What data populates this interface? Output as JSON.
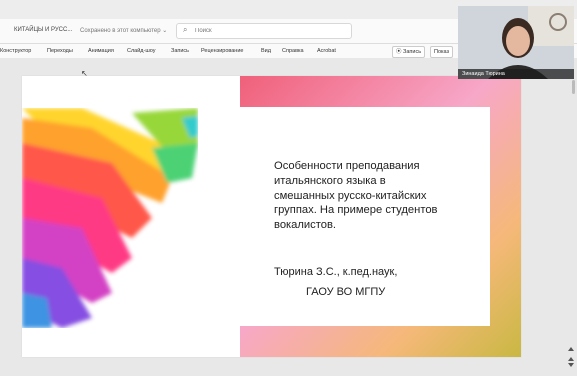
{
  "app": {
    "doc_name": "КИТАЙЦЫ И РУСС...",
    "save_state": "Сохранено в этот компьютер ⌄",
    "search_placeholder": "Поиск"
  },
  "menu": {
    "items": [
      "Конструктор",
      "Переходы",
      "Анимация",
      "Слайд-шоу",
      "Запись",
      "Рецензирование",
      "Вид",
      "Справка",
      "Acrobat"
    ],
    "record_label": "⦿ Запись",
    "show_label": "Показ"
  },
  "slide": {
    "title_lines": [
      "Особенности преподавания",
      "итальянского языка в",
      "смешанных русско-китайских",
      "группах. На примере студентов",
      "вокалистов."
    ],
    "author": "Тюрина З.С., к.пед.наук,",
    "organization": "ГАОУ ВО МГПУ"
  },
  "video": {
    "participant_name": "Зинаида Тюрина"
  },
  "colors": {
    "accent": "#e8456a",
    "frame_gradient": [
      "#f0607a",
      "#f7a7c8",
      "#f6b87a",
      "#c9b842"
    ]
  }
}
